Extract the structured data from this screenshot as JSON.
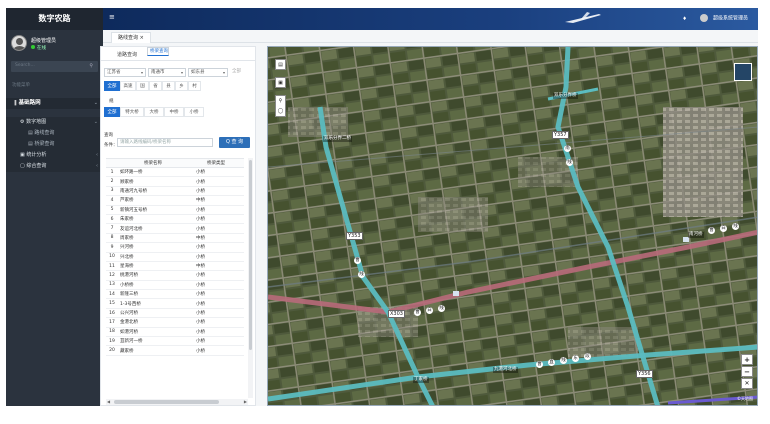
{
  "app": {
    "title": "数字农路"
  },
  "user": {
    "name": "超级管理员",
    "status": "在线"
  },
  "sidebar": {
    "search_placeholder": "Search...",
    "section_label": "功能菜单",
    "items": [
      {
        "label": "基础路网"
      },
      {
        "label": "数字地图"
      },
      {
        "label": "路线查询"
      },
      {
        "label": "桥梁查询"
      },
      {
        "label": "统计分析"
      },
      {
        "label": "综合查询"
      }
    ]
  },
  "topbar": {
    "user_label": "超级系统管理员"
  },
  "tabs": [
    {
      "label": "路线查询 ×"
    }
  ],
  "panel": {
    "tabs": [
      {
        "label": "道路查询"
      },
      {
        "label": "桥梁查询"
      }
    ],
    "selects": [
      {
        "value": "江苏省"
      },
      {
        "value": "南通市"
      },
      {
        "value": "如东县"
      },
      {
        "value": "全部"
      }
    ],
    "level_chips": [
      {
        "label": "全部"
      },
      {
        "label": "高速"
      },
      {
        "label": "国"
      },
      {
        "label": "省"
      },
      {
        "label": "县"
      },
      {
        "label": "乡"
      },
      {
        "label": "村"
      }
    ],
    "size_label": "规",
    "size_chips": [
      {
        "label": "全部"
      },
      {
        "label": "特大桥"
      },
      {
        "label": "大桥"
      },
      {
        "label": "中桥"
      },
      {
        "label": "小桥"
      }
    ],
    "search_label_1": "查询",
    "search_label_2": "条件：",
    "search_placeholder": "请输入路线编码/桥梁名称",
    "search_button": "Q 查 询",
    "table": {
      "headers": [
        "",
        "桥梁名称",
        "桥梁类型"
      ],
      "rows": [
        [
          "1",
          "如环路一桥",
          "小桥"
        ],
        [
          "2",
          "顾家桥",
          "小桥"
        ],
        [
          "3",
          "南通河九号桥",
          "小桥"
        ],
        [
          "4",
          "芦家桥",
          "中桥"
        ],
        [
          "5",
          "新镇河五号桥",
          "小桥"
        ],
        [
          "6",
          "朱家桥",
          "小桥"
        ],
        [
          "7",
          "友谊河北桥",
          "小桥"
        ],
        [
          "8",
          "周家桥",
          "中桥"
        ],
        [
          "9",
          "兴河桥",
          "小桥"
        ],
        [
          "10",
          "兴北桥",
          "小桥"
        ],
        [
          "11",
          "星海桥",
          "中桥"
        ],
        [
          "12",
          "桃港河桥",
          "小桥"
        ],
        [
          "13",
          "小桥桥",
          "小桥"
        ],
        [
          "14",
          "新隆三桥",
          "小桥"
        ],
        [
          "15",
          "1-3号西桥",
          "小桥"
        ],
        [
          "16",
          "公兴河桥",
          "小桥"
        ],
        [
          "17",
          "金港北桥",
          "小桥"
        ],
        [
          "18",
          "如港河桥",
          "小桥"
        ],
        [
          "19",
          "苴新河一桥",
          "小桥"
        ],
        [
          "20",
          "藏家桥",
          "小桥"
        ]
      ]
    }
  },
  "map": {
    "road_labels": {
      "y357": "Y357",
      "y353": "Y353",
      "x303": "X303",
      "y356": "Y356"
    },
    "places": {
      "p1": "双乐分界二桥",
      "p2": "双乐分界桥",
      "p3": "南河桥",
      "p4": "九港河北桥",
      "p5": "丁家桥"
    },
    "road_chars": {
      "a": "南",
      "b": "线",
      "c": "曹",
      "d": "白",
      "e": "线",
      "f": "曹",
      "g": "白",
      "h": "线",
      "i": "曹",
      "j": "线",
      "k": "曹",
      "l": "直",
      "m": "线",
      "n": "东",
      "o": "段"
    },
    "attribution": "©天地图"
  },
  "colors": {
    "sidebar_bg": "#2b333e",
    "topbar_bg": "#1a3f7e",
    "accent": "#1f6fd1",
    "county_road": "#5bbcc0",
    "township_road": "#b86a7a"
  }
}
